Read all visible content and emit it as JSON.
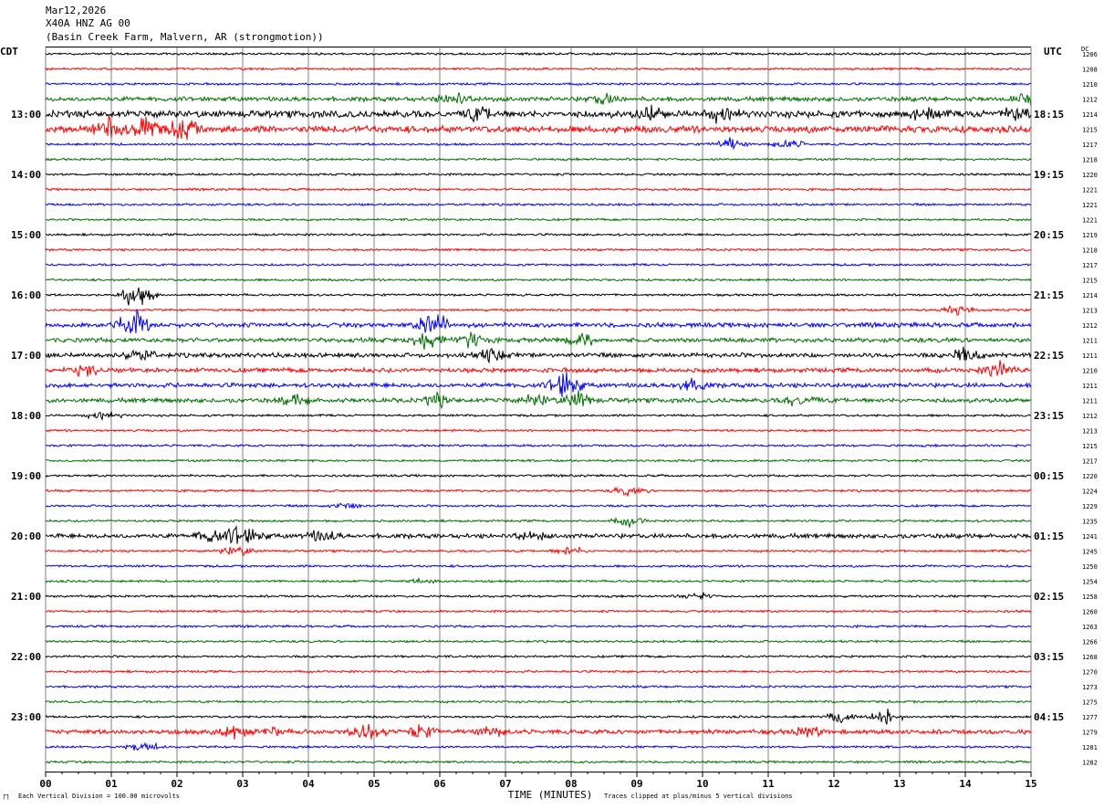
{
  "header": {
    "date": "Mar12,2026",
    "station": "X40A HNZ AG 00",
    "location": "(Basin Creek Farm, Malvern, AR (strongmotion))"
  },
  "left_tz": "CDT",
  "right_tz": "UTC",
  "dc_label": "DC",
  "footer": {
    "scale": "Each Vertical Division = 100.00 microvolts",
    "clip": "Traces clipped at plus/minus 5 vertical divisions",
    "corner": "ㄇ"
  },
  "colors": {
    "trace": [
      "#000000",
      "#ff0000",
      "#0000ff",
      "#007000"
    ],
    "grid": "#808080",
    "background": "#ffffff"
  },
  "chart_data": {
    "type": "line",
    "title": "",
    "xlabel": "TIME (MINUTES)",
    "x_ticks": [
      "00",
      "01",
      "02",
      "03",
      "04",
      "05",
      "06",
      "07",
      "08",
      "09",
      "10",
      "11",
      "12",
      "13",
      "14",
      "15"
    ],
    "xlim": [
      0,
      15
    ],
    "trace_count": 48,
    "minutes_per_trace": 15,
    "left_hour_labels": [
      "13:00",
      "14:00",
      "15:00",
      "16:00",
      "17:00",
      "18:00",
      "19:00",
      "20:00",
      "21:00",
      "22:00",
      "23:00"
    ],
    "right_hour_labels": [
      "18:15",
      "19:15",
      "20:15",
      "21:15",
      "22:15",
      "23:15",
      "00:15",
      "01:15",
      "02:15",
      "03:15",
      "04:15"
    ],
    "dc_offsets": [
      1206,
      1208,
      1210,
      1212,
      1214,
      1215,
      1217,
      1218,
      1220,
      1221,
      1221,
      1221,
      1219,
      1218,
      1217,
      1215,
      1214,
      1213,
      1212,
      1211,
      1211,
      1210,
      1211,
      1211,
      1212,
      1213,
      1215,
      1217,
      1220,
      1224,
      1229,
      1235,
      1241,
      1245,
      1250,
      1254,
      1258,
      1260,
      1263,
      1266,
      1268,
      1270,
      1273,
      1275,
      1277,
      1279,
      1281,
      1282
    ],
    "trace_amplitude": [
      1,
      1,
      1,
      2,
      3,
      3,
      1,
      1,
      1,
      1,
      1,
      1,
      1,
      1,
      1,
      1,
      1,
      1,
      2,
      2,
      2,
      2,
      2,
      2,
      1,
      1,
      1,
      1,
      1,
      1,
      1,
      1,
      2,
      1,
      1,
      1,
      1,
      1,
      1,
      1,
      1,
      1,
      1,
      1,
      1,
      2,
      1,
      1
    ],
    "events": [
      {
        "trace": 3,
        "minute": 6.2,
        "size": 10
      },
      {
        "trace": 3,
        "minute": 8.5,
        "size": 8
      },
      {
        "trace": 3,
        "minute": 15.0,
        "size": 10
      },
      {
        "trace": 4,
        "minute": 6.6,
        "size": 8
      },
      {
        "trace": 4,
        "minute": 9.2,
        "size": 10
      },
      {
        "trace": 4,
        "minute": 10.3,
        "size": 9
      },
      {
        "trace": 4,
        "minute": 13.4,
        "size": 8
      },
      {
        "trace": 4,
        "minute": 14.8,
        "size": 9
      },
      {
        "trace": 5,
        "minute": 1.0,
        "size": 14
      },
      {
        "trace": 5,
        "minute": 1.5,
        "size": 13
      },
      {
        "trace": 5,
        "minute": 2.1,
        "size": 14
      },
      {
        "trace": 5,
        "minute": 1.0,
        "size": 10
      },
      {
        "trace": 6,
        "minute": 10.4,
        "size": 8
      },
      {
        "trace": 6,
        "minute": 11.3,
        "size": 7
      },
      {
        "trace": 16,
        "minute": 1.4,
        "size": 20
      },
      {
        "trace": 17,
        "minute": 13.9,
        "size": 8
      },
      {
        "trace": 18,
        "minute": 1.3,
        "size": 22
      },
      {
        "trace": 18,
        "minute": 5.9,
        "size": 18
      },
      {
        "trace": 19,
        "minute": 5.8,
        "size": 12
      },
      {
        "trace": 19,
        "minute": 6.5,
        "size": 10
      },
      {
        "trace": 19,
        "minute": 8.2,
        "size": 10
      },
      {
        "trace": 20,
        "minute": 1.4,
        "size": 9
      },
      {
        "trace": 20,
        "minute": 6.8,
        "size": 9
      },
      {
        "trace": 20,
        "minute": 14.0,
        "size": 10
      },
      {
        "trace": 21,
        "minute": 0.6,
        "size": 8
      },
      {
        "trace": 21,
        "minute": 14.5,
        "size": 10
      },
      {
        "trace": 22,
        "minute": 7.9,
        "size": 18
      },
      {
        "trace": 22,
        "minute": 9.8,
        "size": 10
      },
      {
        "trace": 23,
        "minute": 3.8,
        "size": 7
      },
      {
        "trace": 23,
        "minute": 6.0,
        "size": 9
      },
      {
        "trace": 23,
        "minute": 7.5,
        "size": 8
      },
      {
        "trace": 23,
        "minute": 8.1,
        "size": 10
      },
      {
        "trace": 23,
        "minute": 11.5,
        "size": 9
      },
      {
        "trace": 24,
        "minute": 0.9,
        "size": 6
      },
      {
        "trace": 29,
        "minute": 8.9,
        "size": 7
      },
      {
        "trace": 30,
        "minute": 4.6,
        "size": 6
      },
      {
        "trace": 31,
        "minute": 8.9,
        "size": 7
      },
      {
        "trace": 32,
        "minute": 2.5,
        "size": 8
      },
      {
        "trace": 32,
        "minute": 2.9,
        "size": 14
      },
      {
        "trace": 32,
        "minute": 3.1,
        "size": 9
      },
      {
        "trace": 32,
        "minute": 4.2,
        "size": 8
      },
      {
        "trace": 32,
        "minute": 7.4,
        "size": 7
      },
      {
        "trace": 33,
        "minute": 2.9,
        "size": 8
      },
      {
        "trace": 33,
        "minute": 8.0,
        "size": 6
      },
      {
        "trace": 35,
        "minute": 5.8,
        "size": 4
      },
      {
        "trace": 36,
        "minute": 9.9,
        "size": 5
      },
      {
        "trace": 44,
        "minute": 12.1,
        "size": 9
      },
      {
        "trace": 44,
        "minute": 12.8,
        "size": 10
      },
      {
        "trace": 45,
        "minute": 2.8,
        "size": 12
      },
      {
        "trace": 45,
        "minute": 3.4,
        "size": 8
      },
      {
        "trace": 45,
        "minute": 4.9,
        "size": 14
      },
      {
        "trace": 45,
        "minute": 5.7,
        "size": 9
      },
      {
        "trace": 45,
        "minute": 6.8,
        "size": 7
      },
      {
        "trace": 45,
        "minute": 11.6,
        "size": 9
      },
      {
        "trace": 46,
        "minute": 1.5,
        "size": 7
      }
    ]
  }
}
